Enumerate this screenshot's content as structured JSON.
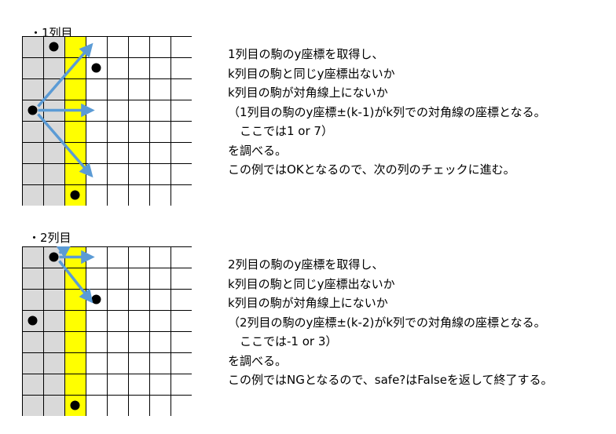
{
  "colors": {
    "checked_column": "#d9d9d9",
    "current_column": "#ffff00",
    "grid_line": "#000000",
    "arrow": "#5b9bd5",
    "piece": "#000000",
    "background": "#ffffff"
  },
  "sections": [
    {
      "label": "・1列目",
      "board": {
        "size": 8,
        "checked_columns": [
          1,
          2
        ],
        "current_column": 3,
        "pieces": [
          {
            "col": 2,
            "row": 1
          },
          {
            "col": 1,
            "row": 4
          },
          {
            "col": 3,
            "row": 8
          }
        ],
        "new_piece": {
          "col": 4,
          "row": 2
        },
        "arrows": [
          {
            "from": {
              "col": 1,
              "row": 4
            },
            "to": "up-diagonal",
            "target": {
              "col": 4,
              "row": 1
            }
          },
          {
            "from": {
              "col": 1,
              "row": 4
            },
            "to": "right",
            "target": {
              "col": 4,
              "row": 4
            }
          },
          {
            "from": {
              "col": 1,
              "row": 4
            },
            "to": "down-diagonal",
            "target": {
              "col": 4,
              "row": 7
            }
          }
        ]
      },
      "lines": [
        "1列目の駒のy座標を取得し、",
        "k列目の駒と同じy座標出ないか",
        "k列目の駒が対角線上にないか",
        "（1列目の駒のy座標±(k-1)がk列での対角線の座標となる。",
        "　ここでは1 or 7）",
        "を調べる。",
        "この例ではOKとなるので、次の列のチェックに進む。"
      ]
    },
    {
      "label": "・2列目",
      "board": {
        "size": 8,
        "checked_columns": [
          1,
          2
        ],
        "current_column": 3,
        "pieces": [
          {
            "col": 2,
            "row": 1
          },
          {
            "col": 1,
            "row": 4
          },
          {
            "col": 3,
            "row": 8
          }
        ],
        "new_piece": {
          "col": 4,
          "row": 3
        },
        "arrows": [
          {
            "from": {
              "col": 2,
              "row": 1
            },
            "to": "up-diagonal",
            "target": {
              "col": 3,
              "row": 0
            }
          },
          {
            "from": {
              "col": 2,
              "row": 1
            },
            "to": "right",
            "target": {
              "col": 4,
              "row": 1
            }
          },
          {
            "from": {
              "col": 2,
              "row": 1
            },
            "to": "down-diagonal",
            "target": {
              "col": 4,
              "row": 3
            }
          }
        ]
      },
      "lines": [
        "2列目の駒のy座標を取得し、",
        "k列目の駒と同じy座標出ないか",
        "k列目の駒が対角線上にないか",
        "（2列目の駒のy座標±(k-2)がk列での対角線の座標となる。",
        "　ここでは-1 or 3）",
        "を調べる。",
        "この例ではNGとなるので、safe?はFalseを返して終了する。"
      ]
    }
  ]
}
